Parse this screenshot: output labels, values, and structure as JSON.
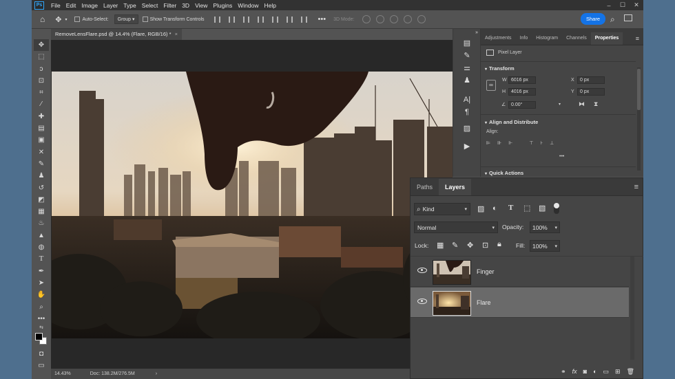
{
  "menu": {
    "app_icon": "Ps",
    "items": [
      "File",
      "Edit",
      "Image",
      "Layer",
      "Type",
      "Select",
      "Filter",
      "3D",
      "View",
      "Plugins",
      "Window",
      "Help"
    ]
  },
  "options_bar": {
    "auto_select_label": "Auto-Select:",
    "auto_select_value": "Group",
    "show_transform_label": "Show Transform Controls",
    "mode_3d_label": "3D Mode:",
    "share_label": "Share"
  },
  "document": {
    "tab_title": "RemoveLensFlare.psd @ 14.4% (Flare, RGB/16) *",
    "close_glyph": "×",
    "zoom": "14.43%",
    "doc_info": "Doc: 138.2M/276.5M",
    "status_arrow": "›"
  },
  "properties": {
    "tabs": [
      "Adjustments",
      "Info",
      "Histogram",
      "Channels",
      "Properties"
    ],
    "active_tab": "Properties",
    "layer_kind": "Pixel Layer",
    "transform_title": "Transform",
    "w_label": "W",
    "w_value": "6016 px",
    "h_label": "H",
    "h_value": "4016 px",
    "x_label": "X",
    "x_value": "0 px",
    "y_label": "Y",
    "y_value": "0 px",
    "angle_value": "0.00°",
    "align_title": "Align and Distribute",
    "align_label": "Align:",
    "more": "•••",
    "quick_actions_title": "Quick Actions"
  },
  "layers_panel": {
    "tabs": [
      "Paths",
      "Layers"
    ],
    "active_tab": "Layers",
    "filter_kind": "Kind",
    "blend_mode": "Normal",
    "opacity_label": "Opacity:",
    "opacity_value": "100%",
    "lock_label": "Lock:",
    "fill_label": "Fill:",
    "fill_value": "100%",
    "layers": [
      {
        "name": "Finger",
        "visible": true,
        "selected": false
      },
      {
        "name": "Flare",
        "visible": true,
        "selected": true
      }
    ]
  },
  "colors": {
    "accent": "#1473e6",
    "chrome_dark": "#323232",
    "panel": "#454545",
    "workspace": "#535353",
    "desktop": "#4e6f8e"
  }
}
